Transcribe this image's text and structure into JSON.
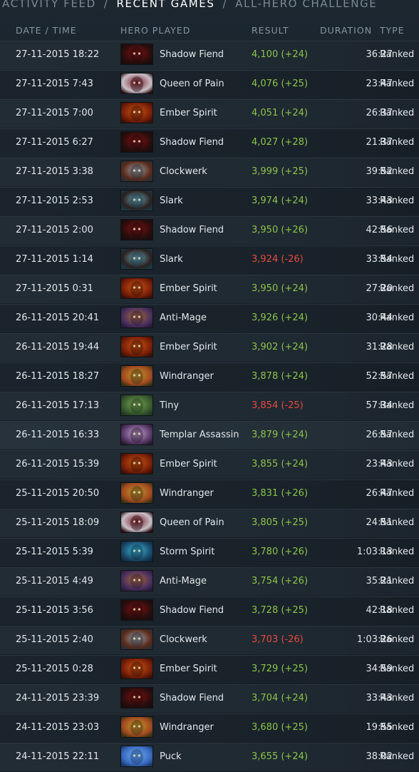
{
  "tabs": [
    {
      "label": "ACTIVITY FEED",
      "active": false
    },
    {
      "label": "RECENT GAMES",
      "active": true
    },
    {
      "label": "ALL-HERO CHALLENGE",
      "active": false
    }
  ],
  "tab_separator": "/",
  "columns": {
    "date": "DATE / TIME",
    "hero": "HERO PLAYED",
    "result": "RESULT",
    "duration": "DURATION",
    "type": "TYPE"
  },
  "colors": {
    "win": "#8bc34a",
    "loss": "#e74a3f"
  },
  "matches": [
    {
      "date": "27-11-2015  18:22",
      "hero": "Shadow Fiend",
      "hero_icon": "shadow-fiend-portrait",
      "result": "4,100 (+24)",
      "outcome": "win",
      "duration": "36:27",
      "type": "Ranked"
    },
    {
      "date": "27-11-2015  7:43",
      "hero": "Queen of Pain",
      "hero_icon": "queen-of-pain-portrait",
      "result": "4,076 (+25)",
      "outcome": "win",
      "duration": "23:47",
      "type": "Ranked"
    },
    {
      "date": "27-11-2015  7:00",
      "hero": "Ember Spirit",
      "hero_icon": "ember-spirit-portrait",
      "result": "4,051 (+24)",
      "outcome": "win",
      "duration": "26:37",
      "type": "Ranked"
    },
    {
      "date": "27-11-2015  6:27",
      "hero": "Shadow Fiend",
      "hero_icon": "shadow-fiend-portrait",
      "result": "4,027 (+28)",
      "outcome": "win",
      "duration": "21:37",
      "type": "Ranked"
    },
    {
      "date": "27-11-2015  3:38",
      "hero": "Clockwerk",
      "hero_icon": "clockwerk-portrait",
      "result": "3,999 (+25)",
      "outcome": "win",
      "duration": "39:52",
      "type": "Ranked"
    },
    {
      "date": "27-11-2015  2:53",
      "hero": "Slark",
      "hero_icon": "slark-portrait",
      "result": "3,974 (+24)",
      "outcome": "win",
      "duration": "33:43",
      "type": "Ranked"
    },
    {
      "date": "27-11-2015  2:00",
      "hero": "Shadow Fiend",
      "hero_icon": "shadow-fiend-portrait",
      "result": "3,950 (+26)",
      "outcome": "win",
      "duration": "42:56",
      "type": "Ranked"
    },
    {
      "date": "27-11-2015  1:14",
      "hero": "Slark",
      "hero_icon": "slark-portrait",
      "result": "3,924 (-26)",
      "outcome": "loss",
      "duration": "33:54",
      "type": "Ranked"
    },
    {
      "date": "27-11-2015  0:31",
      "hero": "Ember Spirit",
      "hero_icon": "ember-spirit-portrait",
      "result": "3,950 (+24)",
      "outcome": "win",
      "duration": "27:20",
      "type": "Ranked"
    },
    {
      "date": "26-11-2015  20:41",
      "hero": "Anti-Mage",
      "hero_icon": "anti-mage-portrait",
      "result": "3,926 (+24)",
      "outcome": "win",
      "duration": "30:44",
      "type": "Ranked"
    },
    {
      "date": "26-11-2015  19:44",
      "hero": "Ember Spirit",
      "hero_icon": "ember-spirit-portrait",
      "result": "3,902 (+24)",
      "outcome": "win",
      "duration": "31:28",
      "type": "Ranked"
    },
    {
      "date": "26-11-2015  18:27",
      "hero": "Windranger",
      "hero_icon": "windranger-portrait",
      "result": "3,878 (+24)",
      "outcome": "win",
      "duration": "52:57",
      "type": "Ranked"
    },
    {
      "date": "26-11-2015  17:13",
      "hero": "Tiny",
      "hero_icon": "tiny-portrait",
      "result": "3,854 (-25)",
      "outcome": "loss",
      "duration": "57:34",
      "type": "Ranked"
    },
    {
      "date": "26-11-2015  16:33",
      "hero": "Templar Assassin",
      "hero_icon": "templar-assassin-portrait",
      "result": "3,879 (+24)",
      "outcome": "win",
      "duration": "26:57",
      "type": "Ranked"
    },
    {
      "date": "26-11-2015  15:39",
      "hero": "Ember Spirit",
      "hero_icon": "ember-spirit-portrait",
      "result": "3,855 (+24)",
      "outcome": "win",
      "duration": "23:43",
      "type": "Ranked"
    },
    {
      "date": "25-11-2015  20:50",
      "hero": "Windranger",
      "hero_icon": "windranger-portrait",
      "result": "3,831 (+26)",
      "outcome": "win",
      "duration": "26:47",
      "type": "Ranked"
    },
    {
      "date": "25-11-2015  18:09",
      "hero": "Queen of Pain",
      "hero_icon": "queen-of-pain-portrait",
      "result": "3,805 (+25)",
      "outcome": "win",
      "duration": "24:51",
      "type": "Ranked"
    },
    {
      "date": "25-11-2015  5:39",
      "hero": "Storm Spirit",
      "hero_icon": "storm-spirit-portrait",
      "result": "3,780 (+26)",
      "outcome": "win",
      "duration": "1:03:13",
      "type": "Ranked"
    },
    {
      "date": "25-11-2015  4:49",
      "hero": "Anti-Mage",
      "hero_icon": "anti-mage-portrait",
      "result": "3,754 (+26)",
      "outcome": "win",
      "duration": "35:21",
      "type": "Ranked"
    },
    {
      "date": "25-11-2015  3:56",
      "hero": "Shadow Fiend",
      "hero_icon": "shadow-fiend-portrait",
      "result": "3,728 (+25)",
      "outcome": "win",
      "duration": "42:18",
      "type": "Ranked"
    },
    {
      "date": "25-11-2015  2:40",
      "hero": "Clockwerk",
      "hero_icon": "clockwerk-portrait",
      "result": "3,703 (-26)",
      "outcome": "loss",
      "duration": "1:03:26",
      "type": "Ranked"
    },
    {
      "date": "25-11-2015  0:28",
      "hero": "Ember Spirit",
      "hero_icon": "ember-spirit-portrait",
      "result": "3,729 (+25)",
      "outcome": "win",
      "duration": "34:59",
      "type": "Ranked"
    },
    {
      "date": "24-11-2015  23:39",
      "hero": "Shadow Fiend",
      "hero_icon": "shadow-fiend-portrait",
      "result": "3,704 (+24)",
      "outcome": "win",
      "duration": "33:43",
      "type": "Ranked"
    },
    {
      "date": "24-11-2015  23:03",
      "hero": "Windranger",
      "hero_icon": "windranger-portrait",
      "result": "3,680 (+25)",
      "outcome": "win",
      "duration": "19:55",
      "type": "Ranked"
    },
    {
      "date": "24-11-2015  22:11",
      "hero": "Puck",
      "hero_icon": "puck-portrait",
      "result": "3,655 (+24)",
      "outcome": "win",
      "duration": "38:02",
      "type": "Ranked"
    }
  ]
}
